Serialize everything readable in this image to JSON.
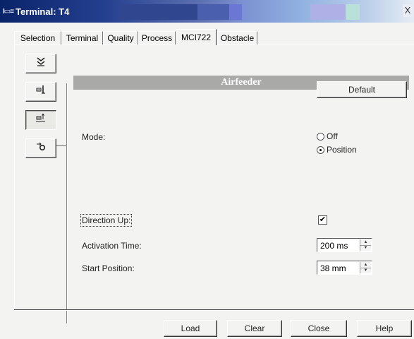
{
  "window": {
    "icon": "terminal-app-icon",
    "title": "Terminal: T4",
    "close_glyph": "X"
  },
  "tabs": [
    {
      "label": "Selection"
    },
    {
      "label": "Terminal"
    },
    {
      "label": "Quality"
    },
    {
      "label": "Process"
    },
    {
      "label": "MCI722",
      "active": true
    },
    {
      "label": "Obstacle"
    }
  ],
  "sidebar": {
    "buttons": [
      {
        "icon": "double-chevron-down-icon",
        "glyph": "⏬"
      },
      {
        "icon": "feeder-icon",
        "glyph": "⊞↓"
      },
      {
        "icon": "airfeeder-icon",
        "glyph": "⊞⇡",
        "pressed": true
      },
      {
        "icon": "obstacle-icon",
        "glyph": "⇥o"
      }
    ]
  },
  "section": {
    "title": "Airfeeder"
  },
  "default_button": "Default",
  "mode": {
    "label": "Mode:",
    "options": [
      {
        "label": "Off",
        "selected": false
      },
      {
        "label": "Position",
        "selected": true
      }
    ]
  },
  "direction_up": {
    "label": "Direction Up:",
    "checked": true,
    "check_glyph": "✔"
  },
  "activation_time": {
    "label": "Activation Time:",
    "value": "200 ms"
  },
  "start_position": {
    "label": "Start Position:",
    "value": "38 mm"
  },
  "footer": {
    "buttons": [
      "Load",
      "Clear",
      "Close",
      "Help"
    ]
  }
}
